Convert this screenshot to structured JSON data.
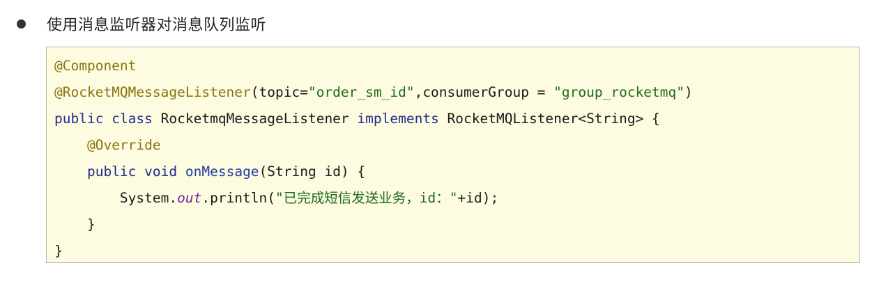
{
  "heading": {
    "text": "使用消息监听器对消息队列监听"
  },
  "code": {
    "lines": [
      {
        "tokens": [
          {
            "t": "@Component",
            "k": "ann"
          }
        ]
      },
      {
        "tokens": [
          {
            "t": "@RocketMQMessageListener",
            "k": "ann"
          },
          {
            "t": "(topic=",
            "k": "plain"
          },
          {
            "t": "\"order_sm_id\"",
            "k": "str"
          },
          {
            "t": ",consumerGroup = ",
            "k": "plain"
          },
          {
            "t": "\"group_rocketmq\"",
            "k": "str"
          },
          {
            "t": ")",
            "k": "plain"
          }
        ]
      },
      {
        "tokens": [
          {
            "t": "public",
            "k": "kw"
          },
          {
            "t": " ",
            "k": "plain"
          },
          {
            "t": "class",
            "k": "kw"
          },
          {
            "t": " RocketmqMessageListener ",
            "k": "plain"
          },
          {
            "t": "implements",
            "k": "kw"
          },
          {
            "t": " RocketMQListener<String> {",
            "k": "plain"
          }
        ]
      },
      {
        "tokens": [
          {
            "t": "    ",
            "k": "plain"
          },
          {
            "t": "@Override",
            "k": "ann"
          }
        ]
      },
      {
        "tokens": [
          {
            "t": "    ",
            "k": "plain"
          },
          {
            "t": "public",
            "k": "kw"
          },
          {
            "t": " ",
            "k": "plain"
          },
          {
            "t": "void",
            "k": "kw"
          },
          {
            "t": " ",
            "k": "plain"
          },
          {
            "t": "onMessage",
            "k": "method"
          },
          {
            "t": "(String id) {",
            "k": "plain"
          }
        ]
      },
      {
        "tokens": [
          {
            "t": "        System.",
            "k": "plain"
          },
          {
            "t": "out",
            "k": "field"
          },
          {
            "t": ".println(",
            "k": "plain"
          },
          {
            "t": "\"已完成短信发送业务，id：\"",
            "k": "str"
          },
          {
            "t": "+id);",
            "k": "plain"
          }
        ]
      },
      {
        "tokens": [
          {
            "t": "    }",
            "k": "plain"
          }
        ]
      },
      {
        "tokens": [
          {
            "t": "}",
            "k": "plain"
          }
        ]
      }
    ]
  }
}
